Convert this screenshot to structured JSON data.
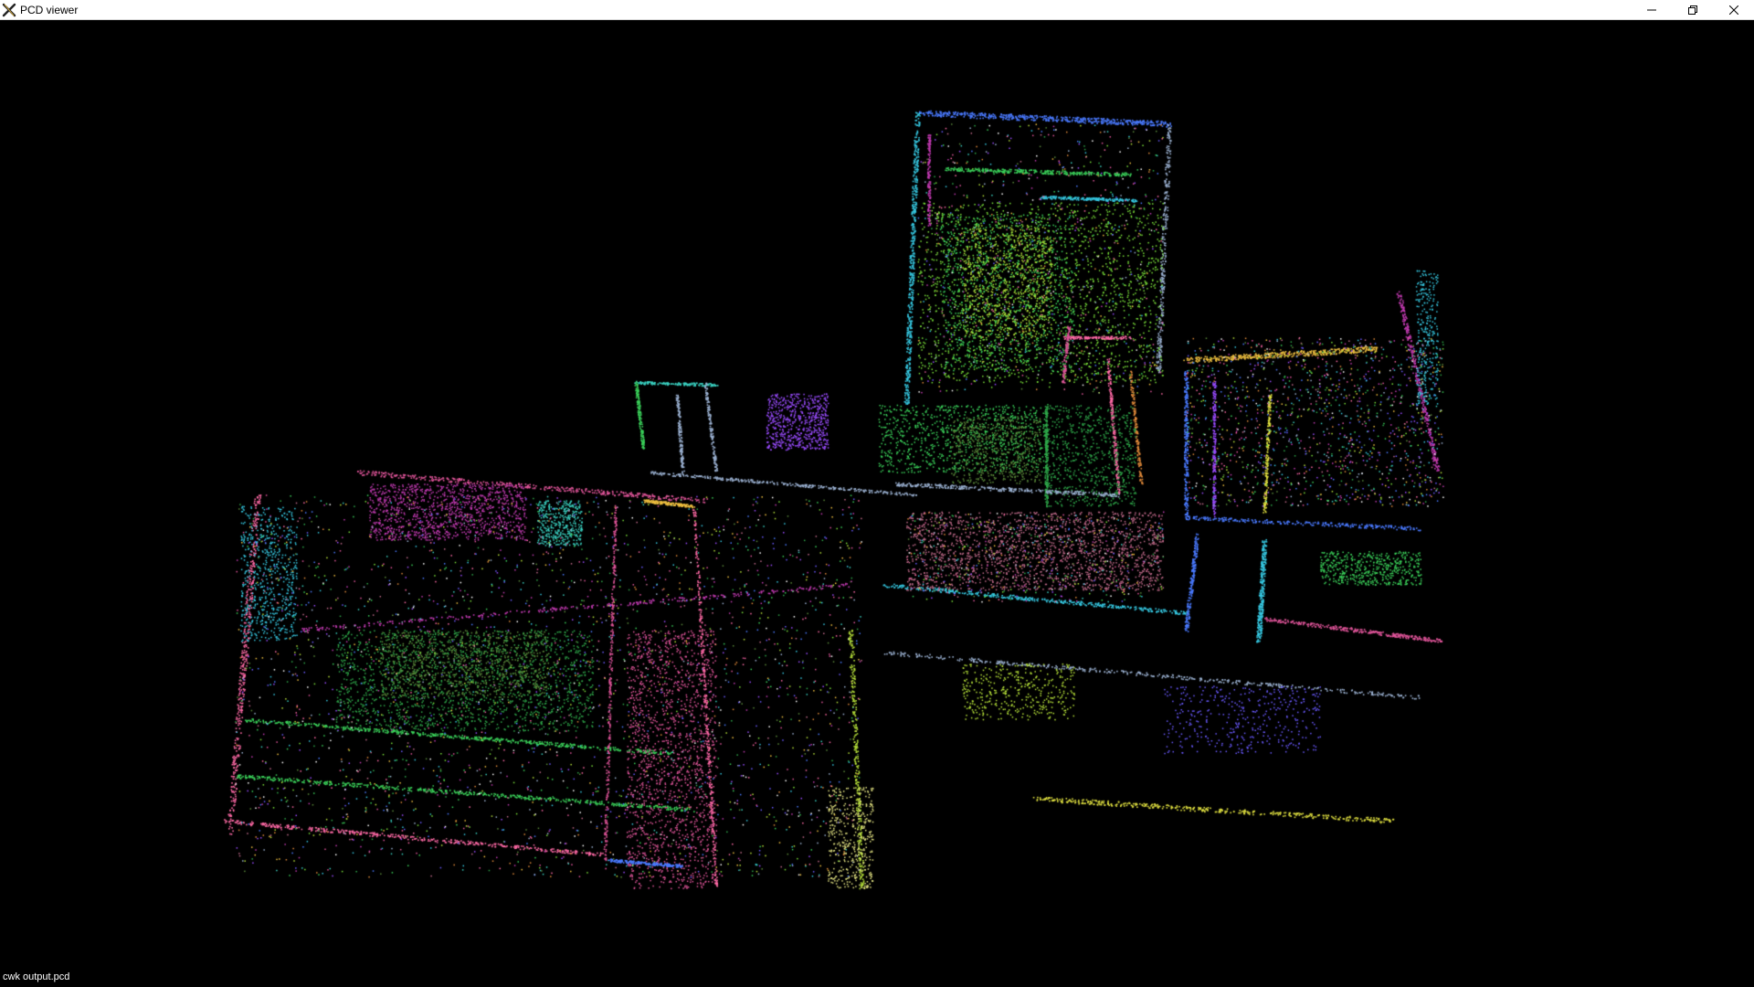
{
  "window": {
    "title": "PCD viewer",
    "controls": {
      "minimize_icon": "minimize-icon",
      "restore_icon": "restore-icon",
      "close_icon": "close-icon"
    }
  },
  "viewport": {
    "background": "#000000",
    "file_label": "cwk output.pcd"
  },
  "palette": [
    "#e0559a",
    "#ff6aa6",
    "#3bd15a",
    "#2fa84a",
    "#7ae03a",
    "#b7e23a",
    "#c03ab0",
    "#9a4cff",
    "#6a5aff",
    "#4a7aff",
    "#36c7e0",
    "#3ad0c0",
    "#f0c040",
    "#e08a3a",
    "#ffffff",
    "#9ab0d0",
    "#c06a8a",
    "#5a8a3a"
  ]
}
